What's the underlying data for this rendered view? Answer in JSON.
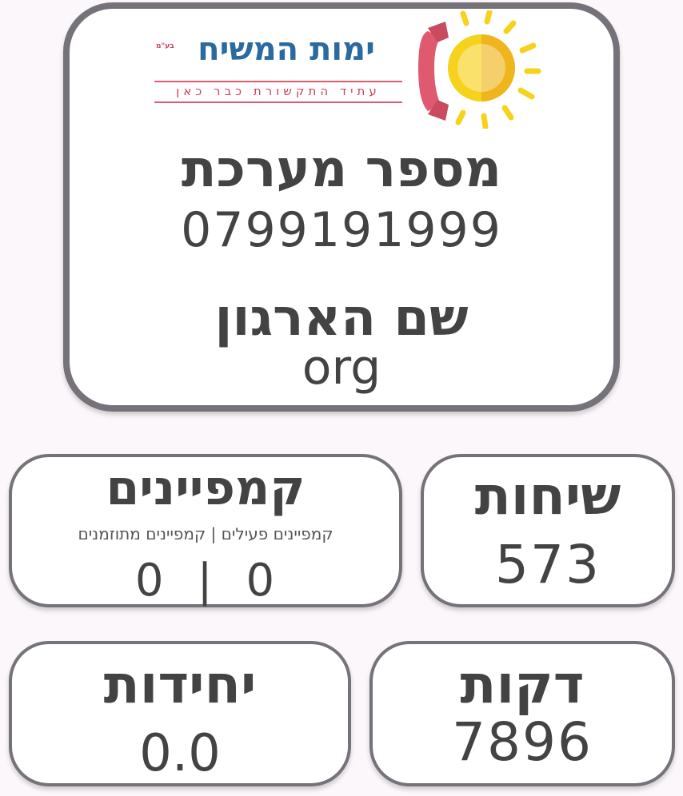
{
  "header": {
    "logo_title": "ימות המשיח",
    "logo_registered": "בע\"מ",
    "logo_tagline": "עתיד התקשורת כבר כאן",
    "system_number_label": "מספר מערכת",
    "system_number": "0799191999",
    "org_name_label": "שם הארגון",
    "org_name": "org"
  },
  "stats": {
    "calls": {
      "label": "שיחות",
      "value": "573"
    },
    "campaigns": {
      "label": "קמפיינים",
      "subtitle": "קמפיינים פעילים | קמפיינים מתוזמנים",
      "scheduled": "0",
      "separator": "|",
      "active": "0"
    },
    "minutes": {
      "label": "דקות",
      "value": "7896"
    },
    "units": {
      "label": "יחידות",
      "value": "0.0"
    }
  },
  "colors": {
    "card_border": "#757379",
    "text": "#434343",
    "logo_blue": "#2a6aa0",
    "logo_red": "#d23f56",
    "sun_yellow": "#f7d21c"
  }
}
